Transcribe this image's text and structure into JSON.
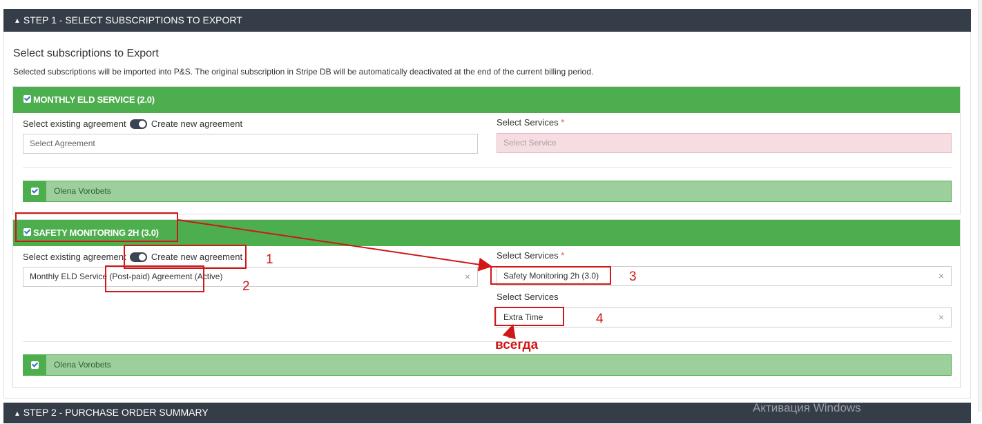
{
  "step1": {
    "label": "STEP 1 - SELECT SUBSCRIPTIONS TO EXPORT"
  },
  "section": {
    "title": "Select subscriptions to Export",
    "description": "Selected subscriptions will be imported into P&S. The original subscription in Stripe DB will be automatically deactivated at the end of the current billing period."
  },
  "cards": [
    {
      "title": "MONTHLY ELD SERVICE (2.0)",
      "checked": true,
      "agreement_label": "Select existing agreement",
      "toggle_label": "Create new agreement",
      "agreement_placeholder": "Select Agreement",
      "services_label": "Select Services",
      "service_placeholder": "Select Service",
      "person": "Olena Vorobets"
    },
    {
      "title": "SAFETY MONITORING 2H (3.0)",
      "checked": true,
      "agreement_label": "Select existing agreement",
      "toggle_label": "Create new agreement",
      "agreement_value": "Monthly ELD Service (Post-paid) Agreement (Active)",
      "services_label": "Select Services",
      "service_value": "Safety Monitoring 2h (3.0)",
      "services_label_2": "Select Services",
      "service_value_2": "Extra Time",
      "person": "Olena Vorobets"
    }
  ],
  "annotations": {
    "n1": "1",
    "n2": "2",
    "n3": "3",
    "n4": "4",
    "note": "всегда"
  },
  "step2": {
    "label": "STEP 2 - PURCHASE ORDER SUMMARY"
  },
  "watermark": "Активация Windows",
  "colors": {
    "header": "#353d48",
    "card_green": "#4cae4c",
    "person_green": "#9dcf9c",
    "annotation_red": "#d01616"
  }
}
